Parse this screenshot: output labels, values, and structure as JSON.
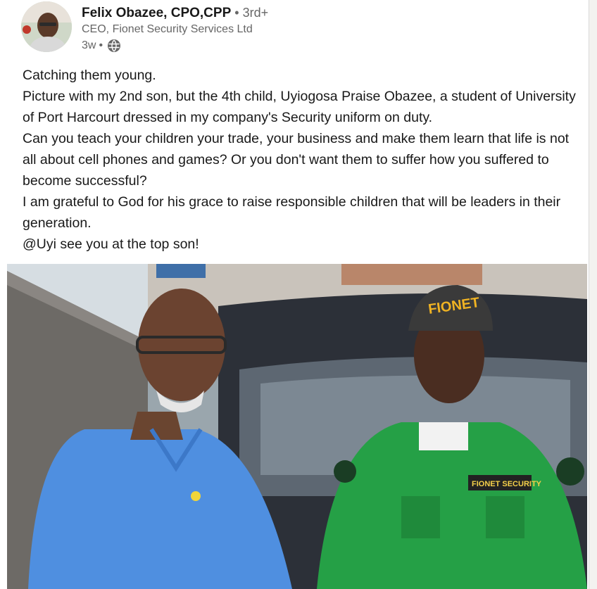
{
  "post": {
    "author": {
      "name": "Felix Obazee, CPO,CPP",
      "separator": " • ",
      "degree": "3rd+",
      "headline": "CEO, Fionet Security Services Ltd",
      "time": "3w",
      "time_separator": "•",
      "visibility_icon": "globe-icon"
    },
    "paragraphs": [
      "Catching them young.",
      "Picture with my 2nd son, but the 4th child, Uyiogosa Praise Obazee, a student of University of Port Harcourt dressed in my company's Security uniform on duty.",
      "Can you teach your children your trade, your business and make them learn that life is not all about cell phones and games? Or you don't want them to suffer how you suffered to become successful?",
      "I am grateful to God for his grace to raise responsible children that will be leaders in their generation.",
      "@Uyi see you at the top son!"
    ],
    "photo": {
      "cap_text": "FIONET",
      "badge_text": "FIONET SECURITY"
    }
  },
  "colors": {
    "accent_green": "#25a046",
    "shirt_blue": "#4f8fe0"
  }
}
